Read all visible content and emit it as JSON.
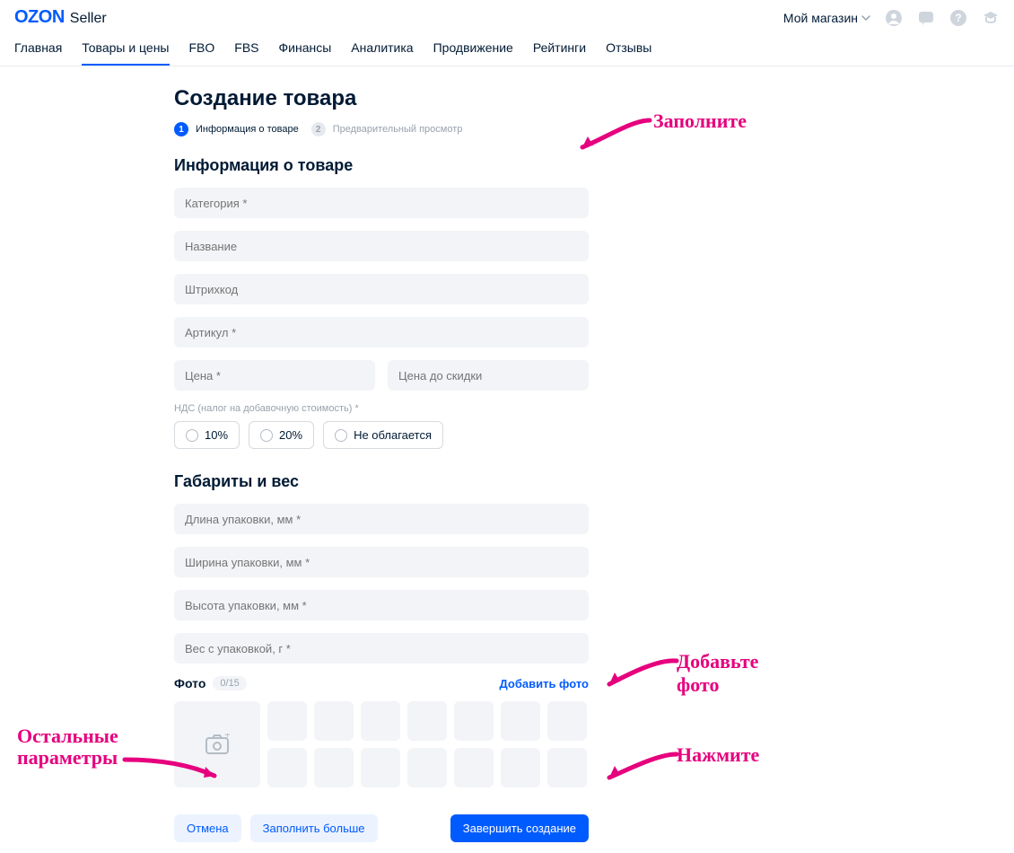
{
  "header": {
    "logo_brand": "OZON",
    "logo_sub": "Seller",
    "my_shop": "Мой магазин"
  },
  "nav": {
    "items": [
      "Главная",
      "Товары и цены",
      "FBO",
      "FBS",
      "Финансы",
      "Аналитика",
      "Продвижение",
      "Рейтинги",
      "Отзывы"
    ],
    "active_index": 1
  },
  "page": {
    "title": "Создание товара",
    "steps": [
      {
        "num": "1",
        "label": "Информация о товаре",
        "active": true
      },
      {
        "num": "2",
        "label": "Предварительный просмотр",
        "active": false
      }
    ]
  },
  "info": {
    "section_title": "Информация о товаре",
    "fields": {
      "category": "Категория *",
      "name": "Название",
      "barcode": "Штрихкод",
      "article": "Артикул *",
      "price": "Цена *",
      "price_before": "Цена до скидки"
    },
    "vat_label": "НДС (налог на добавочную стоимость) *",
    "vat_options": [
      "10%",
      "20%",
      "Не облагается"
    ]
  },
  "dims": {
    "section_title": "Габариты и вес",
    "fields": {
      "length": "Длина упаковки, мм *",
      "width": "Ширина упаковки, мм *",
      "height": "Высота упаковки, мм *",
      "weight": "Вес с упаковкой, г *"
    }
  },
  "photo": {
    "title": "Фото",
    "count": "0/15",
    "add_link": "Добавить фото"
  },
  "buttons": {
    "cancel": "Отмена",
    "fill_more": "Заполнить больше",
    "finish": "Завершить создание"
  },
  "annotations": {
    "fill_in": "Заполните",
    "add_photo": "Добавьте фото",
    "rest_params_1": "Остальные",
    "rest_params_2": "параметры",
    "press": "Нажмите"
  }
}
